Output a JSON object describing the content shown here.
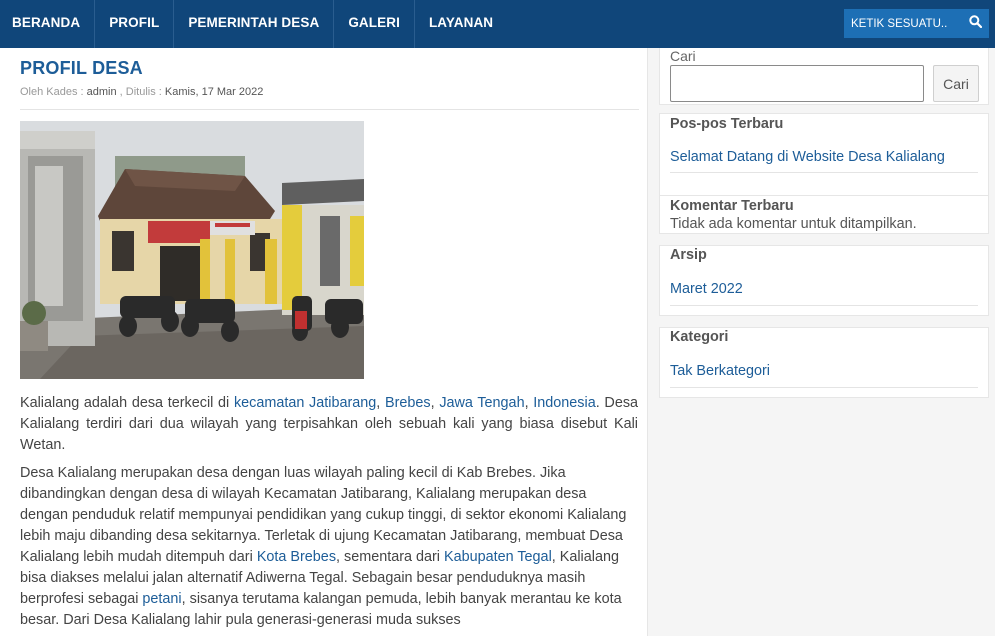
{
  "nav": {
    "items": [
      {
        "label": "BERANDA"
      },
      {
        "label": "PROFIL"
      },
      {
        "label": "PEMERINTAH DESA"
      },
      {
        "label": "GALERI"
      },
      {
        "label": "LAYANAN"
      }
    ],
    "search_placeholder": "KETIK SESUATU.."
  },
  "post": {
    "title": "PROFIL DESA",
    "meta_by": "Oleh Kades : ",
    "author": "admin",
    "meta_written": " , Ditulis : ",
    "date": "Kamis, 17 Mar 2022",
    "p1": {
      "t1": "Kalialang adalah desa terkecil di ",
      "l1": "kecamatan Jatibarang",
      "t2": ", ",
      "l2": "Brebes",
      "t3": ", ",
      "l3": "Jawa Tengah",
      "t4": ", ",
      "l4": "Indonesia",
      "t5": ". Desa Kalialang terdiri dari dua wilayah yang terpisahkan oleh sebuah kali yang biasa disebut Kali Wetan."
    },
    "p2": {
      "t1": "Desa Kalialang merupakan desa dengan luas wilayah paling kecil di Kab Brebes. Jika dibandingkan dengan desa di wilayah Kecamatan Jatibarang, Kalialang merupakan desa dengan penduduk relatif mempunyai pendidikan yang cukup tinggi, di sektor ekonomi Kalialang lebih maju dibanding desa sekitarnya. Terletak di ujung Kecamatan Jatibarang, membuat Desa Kalialang lebih mudah ditempuh dari ",
      "l1": "Kota Brebes",
      "t2": ", sementara dari ",
      "l2": "Kabupaten Tegal",
      "t3": ", Kalialang bisa diakses melalui jalan alternatif Adiwerna Tegal. Sebagain besar penduduknya masih berprofesi sebagai ",
      "l3": "petani",
      "t4": ", sisanya terutama kalangan pemuda, lebih banyak merantau ke kota besar. Dari Desa Kalialang lahir pula generasi-generasi muda sukses"
    }
  },
  "sidebar": {
    "search_label": "Cari",
    "search_button": "Cari",
    "recent_posts_title": "Pos-pos Terbaru",
    "recent_posts": [
      "Selamat Datang di Website Desa Kalialang"
    ],
    "recent_comments_title": "Komentar Terbaru",
    "recent_comments_empty": "Tidak ada komentar untuk ditampilkan.",
    "archives_title": "Arsip",
    "archives": [
      "Maret 2022"
    ],
    "categories_title": "Kategori",
    "categories": [
      "Tak Berkategori"
    ]
  }
}
